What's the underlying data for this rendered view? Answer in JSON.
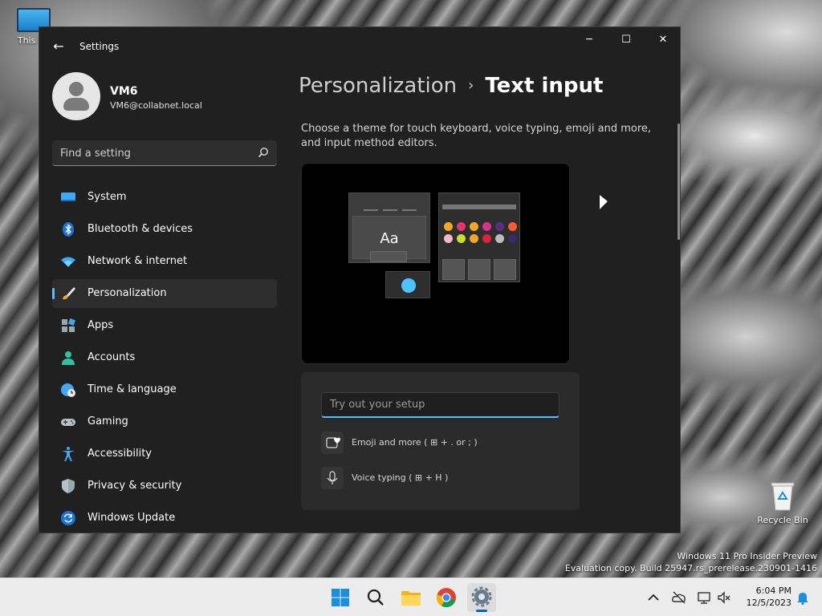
{
  "desktop": {
    "icons": [
      {
        "label": "This PC"
      },
      {
        "label": "Recycle Bin"
      }
    ],
    "watermark": {
      "line1": "Windows 11 Pro Insider Preview",
      "line2": "Evaluation copy. Build 25947.rs_prerelease.230901-1416"
    }
  },
  "window": {
    "app_title": "Settings",
    "controls": {
      "minimize": "─",
      "maximize": "☐",
      "close": "✕"
    },
    "back": "←"
  },
  "profile": {
    "name": "VM6",
    "email": "VM6@collabnet.local"
  },
  "search": {
    "placeholder": "Find a setting"
  },
  "sidebar": {
    "items": [
      {
        "label": "System",
        "icon": "monitor-icon"
      },
      {
        "label": "Bluetooth & devices",
        "icon": "bluetooth-icon"
      },
      {
        "label": "Network & internet",
        "icon": "wifi-icon"
      },
      {
        "label": "Personalization",
        "icon": "brush-icon",
        "active": true
      },
      {
        "label": "Apps",
        "icon": "apps-icon"
      },
      {
        "label": "Accounts",
        "icon": "person-icon"
      },
      {
        "label": "Time & language",
        "icon": "globe-clock-icon"
      },
      {
        "label": "Gaming",
        "icon": "gamepad-icon"
      },
      {
        "label": "Accessibility",
        "icon": "accessibility-icon"
      },
      {
        "label": "Privacy & security",
        "icon": "shield-icon"
      },
      {
        "label": "Windows Update",
        "icon": "update-icon"
      }
    ]
  },
  "main": {
    "breadcrumb": {
      "parent": "Personalization",
      "separator": "›",
      "current": "Text input"
    },
    "description": "Choose a theme for touch keyboard, voice typing, emoji and more, and input method editors.",
    "preview": {
      "sample_text": "Aa"
    },
    "tryout": {
      "placeholder": "Try out your setup",
      "emoji_hint": "Emoji and more ( ⊞ + . or ; )",
      "voice_hint": "Voice typing ( ⊞ + H )"
    }
  },
  "taskbar": {
    "apps": [
      "start-icon",
      "search-icon",
      "file-explorer-icon",
      "chrome-icon",
      "settings-icon"
    ],
    "clock": {
      "time": "6:04 PM",
      "date": "12/5/2023"
    }
  },
  "colors": {
    "accent": "#4cc2ff",
    "window_bg": "#202020",
    "taskbar_bg": "#ececec"
  }
}
